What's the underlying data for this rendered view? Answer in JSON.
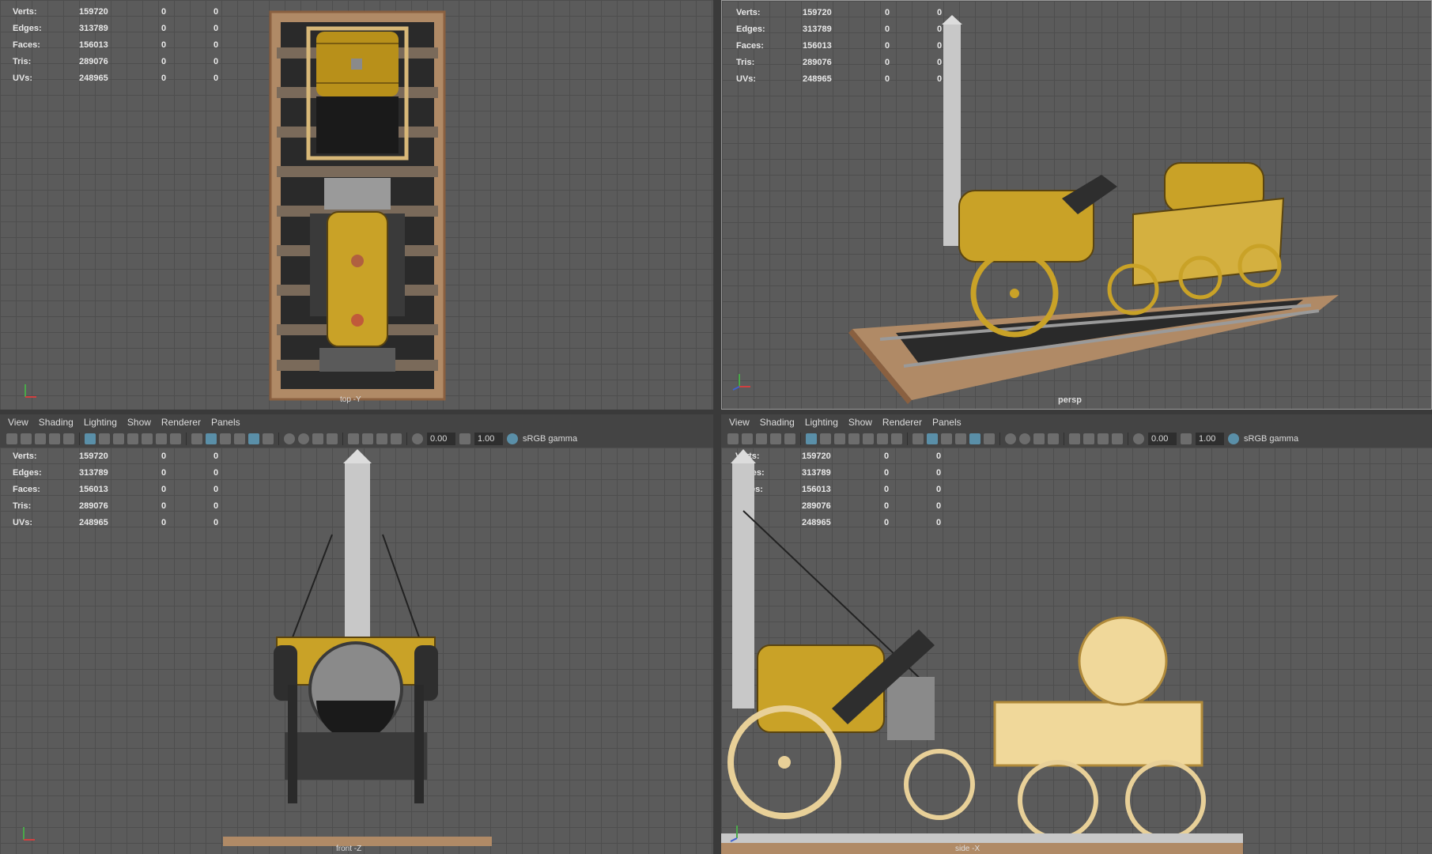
{
  "stats": [
    {
      "label": "Verts:",
      "v1": "159720",
      "v2": "0",
      "v3": "0"
    },
    {
      "label": "Edges:",
      "v1": "313789",
      "v2": "0",
      "v3": "0"
    },
    {
      "label": "Faces:",
      "v1": "156013",
      "v2": "0",
      "v3": "0"
    },
    {
      "label": "Tris:",
      "v1": "289076",
      "v2": "0",
      "v3": "0"
    },
    {
      "label": "UVs:",
      "v1": "248965",
      "v2": "0",
      "v3": "0"
    }
  ],
  "menu": {
    "view": "View",
    "shading": "Shading",
    "lighting": "Lighting",
    "show": "Show",
    "renderer": "Renderer",
    "panels": "Panels"
  },
  "toolbar": {
    "exposure": "0.00",
    "gamma": "1.00",
    "color_space": "sRGB gamma"
  },
  "cameras": {
    "top": "top -Y",
    "persp": "persp",
    "front": "front -Z",
    "side": "side -X"
  },
  "colors": {
    "viewport_bg": "#5b5b5b",
    "grid": "#4e4e4e",
    "panel": "#444444",
    "accent": "#5a8fa8",
    "brass": "#c9a227"
  }
}
